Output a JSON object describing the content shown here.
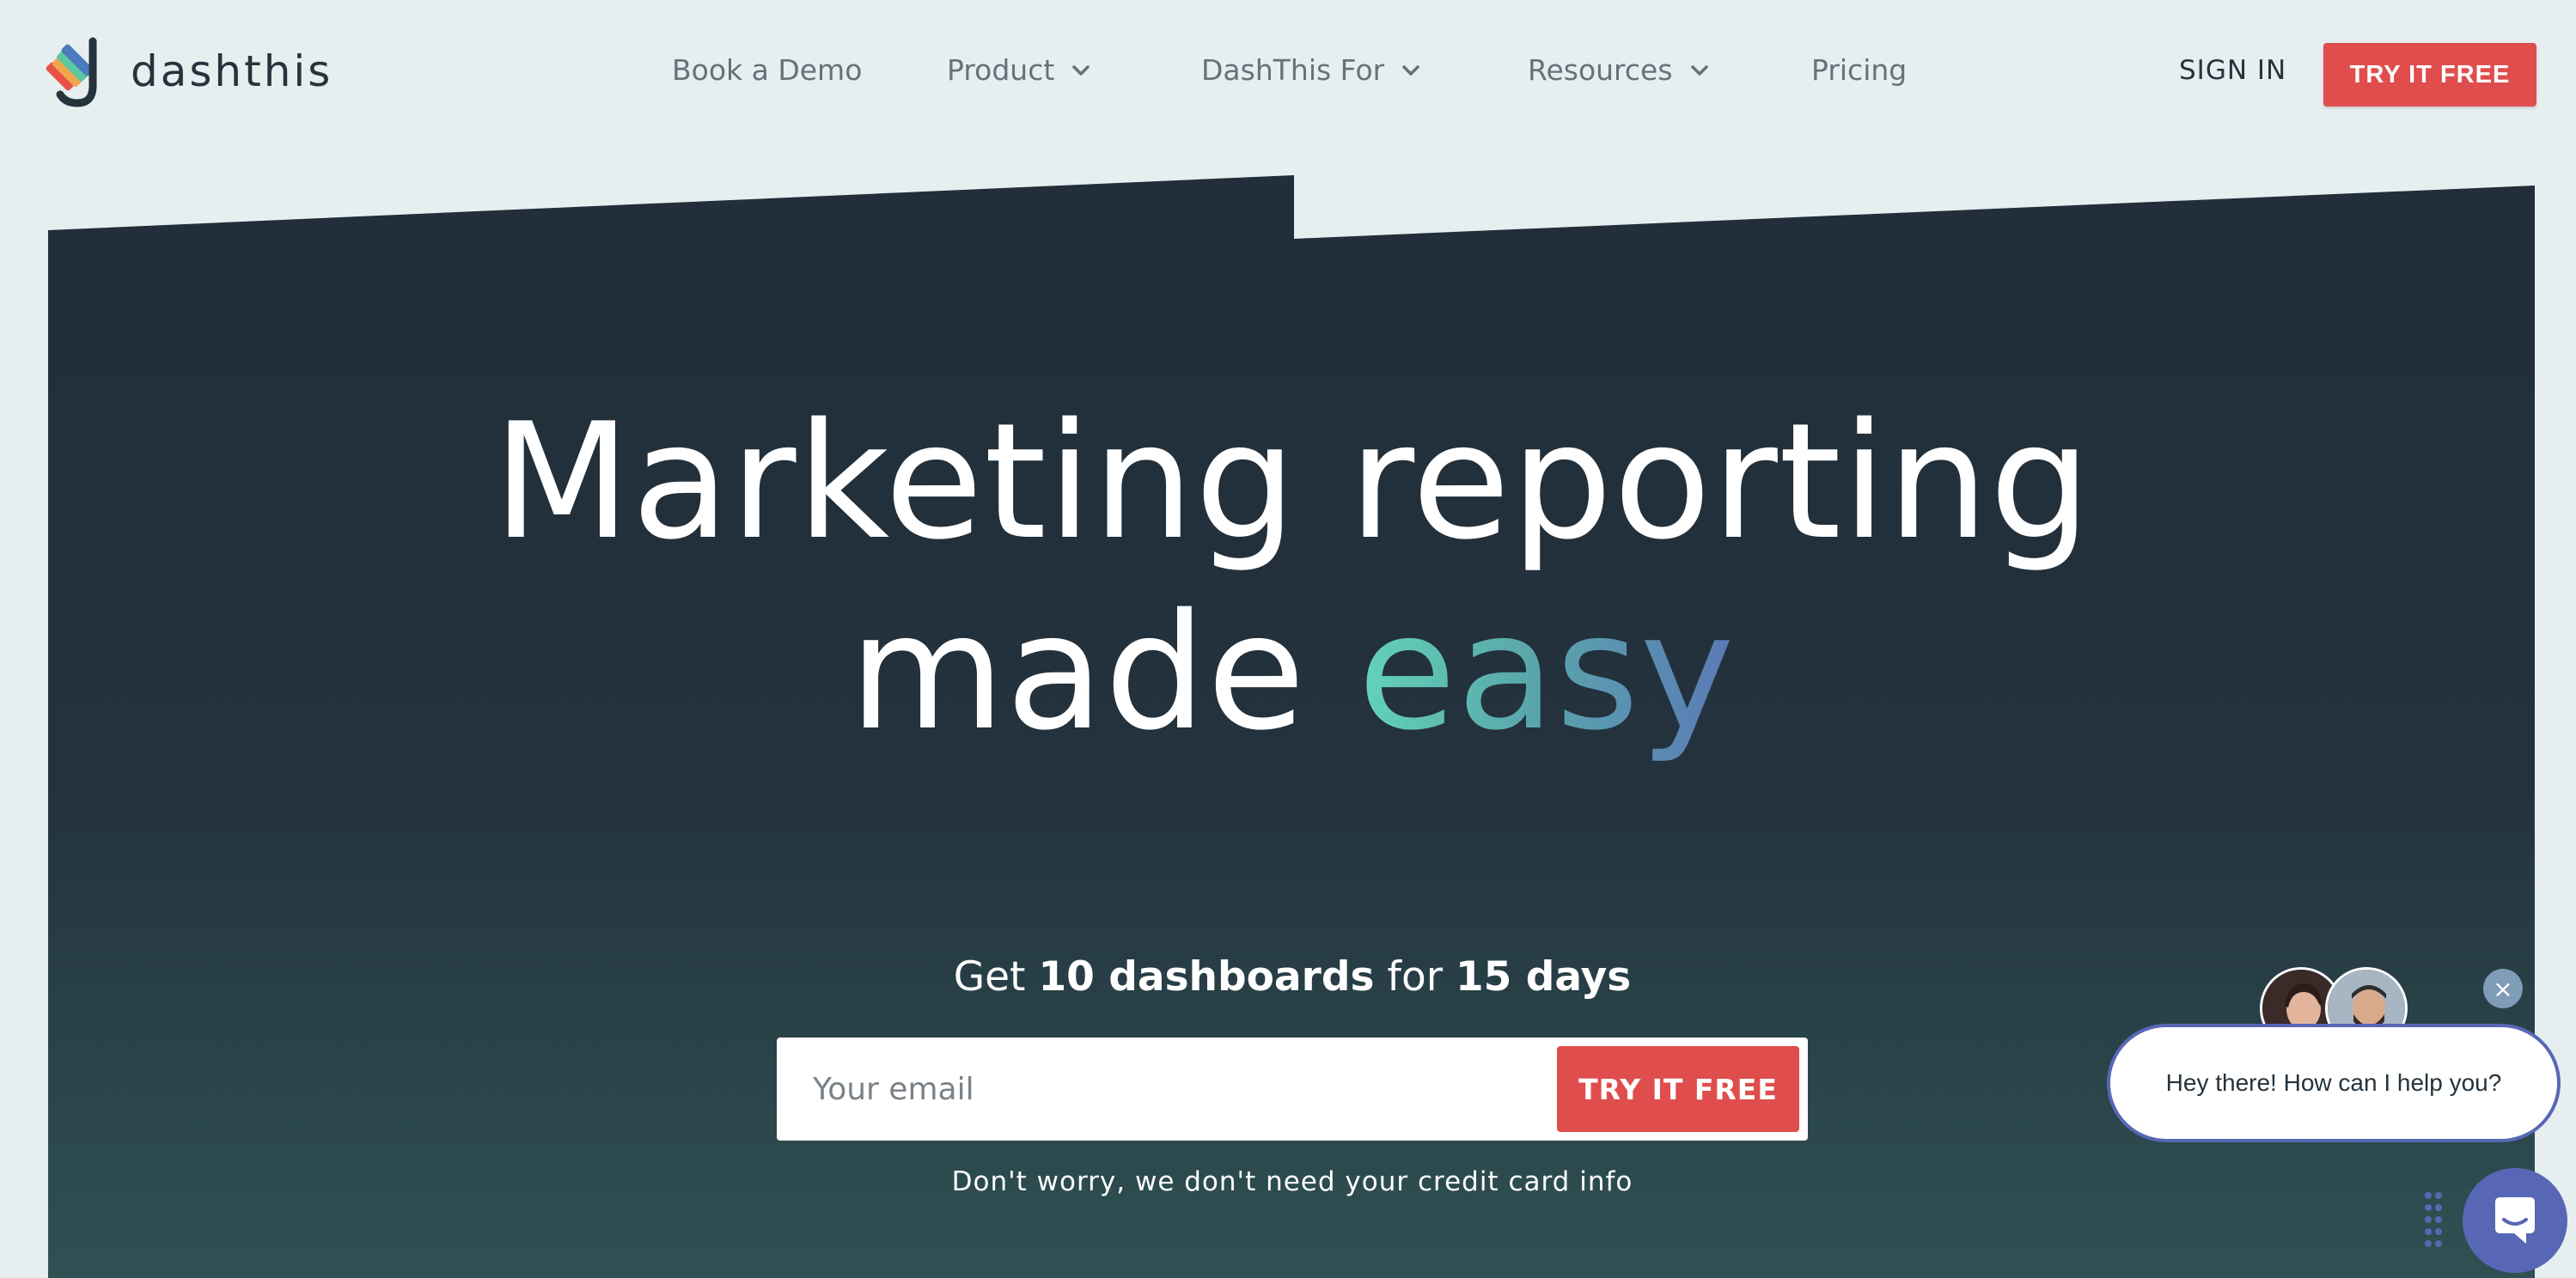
{
  "logo": {
    "text": "dashthis",
    "icon": "dashthis-logo-mark"
  },
  "nav": {
    "book_demo": "Book a Demo",
    "product": "Product",
    "dashthis_for": "DashThis For",
    "resources": "Resources",
    "pricing": "Pricing",
    "sign_in": "SIGN IN",
    "try_free": "TRY IT FREE"
  },
  "hero": {
    "headline_line1": "Marketing reporting",
    "headline_line2_start": "made",
    "headline_line2_highlight": "easy",
    "offer_prefix": "Get",
    "offer_dashboards": "10 dashboards",
    "offer_mid": "for",
    "offer_days": "15 days",
    "email_placeholder": "Your email",
    "submit_label": "TRY IT FREE",
    "note": "Don't worry, we don't need your credit card info"
  },
  "chat": {
    "greeting": "Hey there! How can I help you?",
    "close_glyph": "×"
  },
  "colors": {
    "accent_red": "#e04d4d",
    "hero_dark": "#222e39",
    "hero_teal": "#2f5153",
    "easy_gradient_start": "#63d3b7",
    "easy_gradient_end": "#5a79b6",
    "chat_blue": "#5867b5",
    "page_bg": "#e6eef0"
  }
}
